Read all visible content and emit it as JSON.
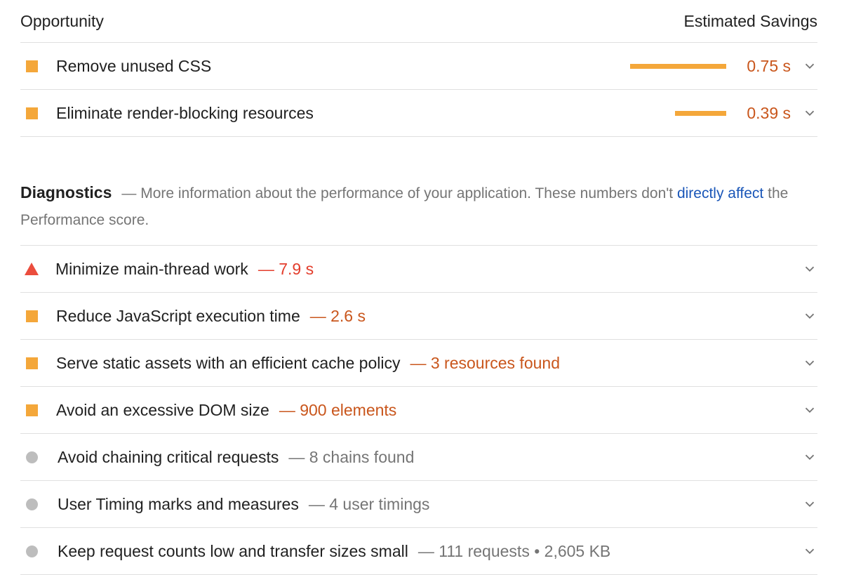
{
  "opportunity": {
    "header_left": "Opportunity",
    "header_right": "Estimated Savings",
    "items": [
      {
        "title": "Remove unused CSS",
        "savings": "0.75 s",
        "bar_fraction": 1.0
      },
      {
        "title": "Eliminate render-blocking resources",
        "savings": "0.39 s",
        "bar_fraction": 0.53
      }
    ]
  },
  "diagnostics": {
    "heading": "Diagnostics",
    "desc_prefix": "— More information about the performance of your application. These numbers don't",
    "link_text": "directly affect",
    "desc_suffix": "the Performance score.",
    "items": [
      {
        "title": "Minimize main-thread work",
        "detail": "— 7.9 s",
        "marker": "triangle",
        "tone": "red"
      },
      {
        "title": "Reduce JavaScript execution time",
        "detail": "— 2.6 s",
        "marker": "square",
        "tone": "orange"
      },
      {
        "title": "Serve static assets with an efficient cache policy",
        "detail": "— 3 resources found",
        "marker": "square",
        "tone": "orange"
      },
      {
        "title": "Avoid an excessive DOM size",
        "detail": "— 900 elements",
        "marker": "square",
        "tone": "orange"
      },
      {
        "title": "Avoid chaining critical requests",
        "detail": "— 8 chains found",
        "marker": "circle",
        "tone": "gray"
      },
      {
        "title": "User Timing marks and measures",
        "detail": "— 4 user timings",
        "marker": "circle",
        "tone": "gray"
      },
      {
        "title": "Keep request counts low and transfer sizes small",
        "detail": "— 111 requests • 2,605 KB",
        "marker": "circle",
        "tone": "gray"
      }
    ]
  },
  "colors": {
    "average": "#f4a73a",
    "fail": "#eb4d3d",
    "info": "#bdbdbd",
    "link": "#1a56b8"
  }
}
